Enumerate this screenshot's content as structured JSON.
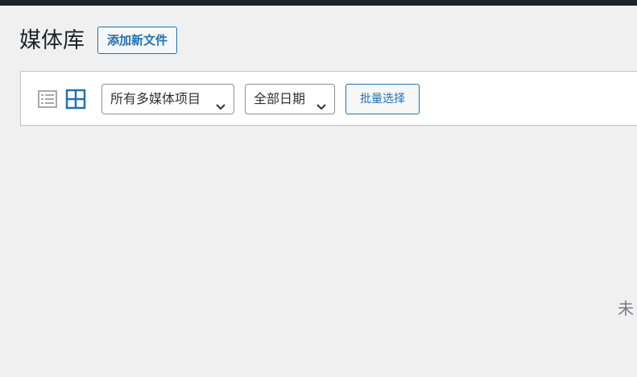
{
  "page": {
    "title": "媒体库",
    "add_new_label": "添加新文件"
  },
  "toolbar": {
    "view_modes": [
      {
        "name": "list",
        "icon": "list-view-icon",
        "active": false
      },
      {
        "name": "grid",
        "icon": "grid-view-icon",
        "active": true
      }
    ],
    "type_filter": {
      "selected": "所有多媒体项目"
    },
    "date_filter": {
      "selected": "全部日期"
    },
    "bulk_select_label": "批量选择"
  },
  "main": {
    "empty_message_partial": "未"
  },
  "colors": {
    "accent": "#2271b1",
    "admin_bar": "#1d2327",
    "background": "#f0f0f1",
    "inactive_icon": "#a7aaad"
  }
}
